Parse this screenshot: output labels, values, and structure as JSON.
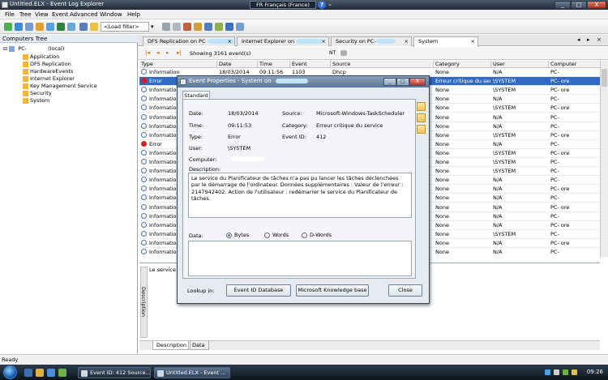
{
  "window": {
    "title": "Untitled.ELX - Event Log Explorer",
    "language": "FR Français (France)",
    "help": "?",
    "minimize": "_",
    "maximize": "□",
    "close": "X"
  },
  "menu": [
    "File",
    "Tree",
    "View",
    "Event",
    "Advanced",
    "Window",
    "Help"
  ],
  "toolbar": {
    "load_filter": "<Load filter>"
  },
  "tree": {
    "header": "Computers Tree",
    "root": "PC-",
    "root_suffix": "(local)",
    "items": [
      "Application",
      "DFS Replication",
      "HardwareEvents",
      "Internet Explorer",
      "Key Management Service",
      "Security",
      "System"
    ]
  },
  "tabs": [
    "DFS Replication on PC",
    "Internet Explorer on",
    "Security on PC-",
    "System"
  ],
  "nav": {
    "count": "Showing 3161 event(s)",
    "nt": "NT"
  },
  "columns": [
    "Type",
    "Date",
    "Time",
    "Event",
    "Source",
    "Category",
    "User",
    "Computer"
  ],
  "rows": [
    {
      "type": "Information",
      "date": "18/03/2014",
      "time": "09:11:56",
      "event": "1103",
      "source": "Dhcp",
      "category": "None",
      "user": "N/A",
      "computer": "PC-"
    },
    {
      "type": "Error",
      "date": "",
      "time": "",
      "event": "",
      "source": "",
      "category": "Erreur critique du service",
      "user": "\\SYSTEM",
      "computer": "PC-        ore"
    },
    {
      "type": "Information",
      "date": "",
      "time": "",
      "event": "",
      "source": "",
      "category": "None",
      "user": "\\SYSTEM",
      "computer": "PC-        ore"
    },
    {
      "type": "Information",
      "date": "",
      "time": "",
      "event": "",
      "source": "",
      "category": "None",
      "user": "N/A",
      "computer": "PC-"
    },
    {
      "type": "Information",
      "date": "",
      "time": "",
      "event": "",
      "source": "",
      "category": "None",
      "user": "\\SYSTEM",
      "computer": "PC-        ore"
    },
    {
      "type": "Information",
      "date": "",
      "time": "",
      "event": "",
      "source": "",
      "category": "None",
      "user": "N/A",
      "computer": "PC-"
    },
    {
      "type": "Information",
      "date": "",
      "time": "",
      "event": "",
      "source": "",
      "category": "None",
      "user": "N/A",
      "computer": "PC-"
    },
    {
      "type": "Information",
      "date": "",
      "time": "",
      "event": "",
      "source": "",
      "category": "None",
      "user": "\\SYSTEM",
      "computer": "PC-        ore"
    },
    {
      "type": "Error",
      "date": "",
      "time": "",
      "event": "",
      "source": "",
      "category": "None",
      "user": "N/A",
      "computer": "PC-"
    },
    {
      "type": "Information",
      "date": "",
      "time": "",
      "event": "",
      "source": "",
      "category": "None",
      "user": "\\SYSTEM",
      "computer": "PC-        ore"
    },
    {
      "type": "Information",
      "date": "",
      "time": "",
      "event": "",
      "source": "",
      "category": "None",
      "user": "\\SYSTEM",
      "computer": "PC-"
    },
    {
      "type": "Information",
      "date": "",
      "time": "",
      "event": "",
      "source": "",
      "category": "None",
      "user": "\\SYSTEM",
      "computer": "PC-"
    },
    {
      "type": "Information",
      "date": "",
      "time": "",
      "event": "",
      "source": "",
      "category": "None",
      "user": "N/A",
      "computer": "PC-"
    },
    {
      "type": "Information",
      "date": "",
      "time": "",
      "event": "",
      "source": "",
      "category": "None",
      "user": "N/A",
      "computer": "PC-        ore"
    },
    {
      "type": "Information",
      "date": "",
      "time": "",
      "event": "",
      "source": "",
      "category": "None",
      "user": "N/A",
      "computer": "PC-"
    },
    {
      "type": "Information",
      "date": "",
      "time": "",
      "event": "",
      "source": "",
      "category": "None",
      "user": "N/A",
      "computer": "PC-        ore"
    },
    {
      "type": "Information",
      "date": "",
      "time": "",
      "event": "",
      "source": "",
      "category": "None",
      "user": "N/A",
      "computer": "PC-"
    },
    {
      "type": "Information",
      "date": "",
      "time": "",
      "event": "",
      "source": "",
      "category": "None",
      "user": "N/A",
      "computer": "PC-        ore"
    },
    {
      "type": "Information",
      "date": "",
      "time": "",
      "event": "",
      "source": "",
      "category": "None",
      "user": "\\SYSTEM",
      "computer": "PC-"
    },
    {
      "type": "Information",
      "date": "",
      "time": "",
      "event": "",
      "source": "",
      "category": "None",
      "user": "N/A",
      "computer": "PC-        ore"
    },
    {
      "type": "Information",
      "date": "",
      "time": "",
      "event": "",
      "source": "",
      "category": "None",
      "user": "N/A",
      "computer": "PC-"
    }
  ],
  "description": {
    "label": "Description",
    "text": "Le service d                                                                                                                  upplémentaires : Valeur de l'erreur : 2147942402. Action de l'utilisateur : redémarrer",
    "tabs": [
      "Description",
      "Data"
    ]
  },
  "status": "Ready",
  "dialog": {
    "title": "Event Properties - System on",
    "tab": "Standard",
    "date_label": "Date:",
    "date": "18/03/2014",
    "source_label": "Source:",
    "source": "Microsoft-Windows-TaskScheduler",
    "time_label": "Time:",
    "time": "09:11:53",
    "category_label": "Category:",
    "category": "Erreur critique du service",
    "type_label": "Type:",
    "type": "Error",
    "eventid_label": "Event ID:",
    "event_id": "412",
    "user_label": "User:",
    "user": "\\SYSTEM",
    "computer_label": "Computer:",
    "description_label": "Description:",
    "description": "Le service du Planificateur de tâches n'a pas pu lancer les tâches déclenchées par le démarrage de l'ordinateur. Données supplémentaires : Valeur de l'erreur : 2147942402. Action de l'utilisateur : redémarrer le service du Planificateur de tâches.",
    "data_label": "Data:",
    "radio_bytes": "Bytes",
    "radio_words": "Words",
    "radio_dwords": "D-Words",
    "lookup_label": "Lookup in:",
    "btn_eventid": "Event ID Database",
    "btn_kb": "Microsoft Knowledge base",
    "btn_close": "Close"
  },
  "taskbar": {
    "task1": "Event ID: 412 Source...",
    "task2": "Untitled.ELX - Event ...",
    "clock": "09:26"
  }
}
